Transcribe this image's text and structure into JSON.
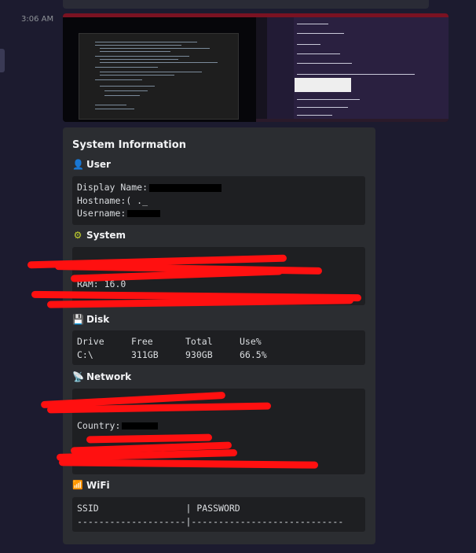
{
  "message": {
    "timestamp": "3:06 AM"
  },
  "embed": {
    "title": "System Information",
    "user": {
      "heading": "User",
      "icon": "user-icon",
      "lines": {
        "display_name_label": "Display Name:",
        "hostname_label": "Hostname:",
        "hostname_partial": "( ._",
        "username_label": "Username:"
      }
    },
    "system": {
      "heading": "System",
      "icon": "cpu-icon",
      "ram_line": "RAM: 16.0"
    },
    "disk": {
      "heading": "Disk",
      "icon": "floppy-disk-icon",
      "columns": [
        "Drive",
        "Free",
        "Total",
        "Use%"
      ],
      "rows": [
        [
          "C:\\",
          "311GB",
          "930GB",
          "66.5%"
        ]
      ]
    },
    "network": {
      "heading": "Network",
      "icon": "satellite-icon",
      "country_label": "Country:"
    },
    "wifi": {
      "heading": "WiFi",
      "icon": "signal-bars-icon",
      "header_line": "SSID                | PASSWORD",
      "separator_line": "--------------------|----------------------------"
    }
  },
  "colors": {
    "background": "#1c1b2f",
    "embed_background": "#2b2d31",
    "code_background": "#1e1f22",
    "redaction_red": "#ff1010"
  }
}
